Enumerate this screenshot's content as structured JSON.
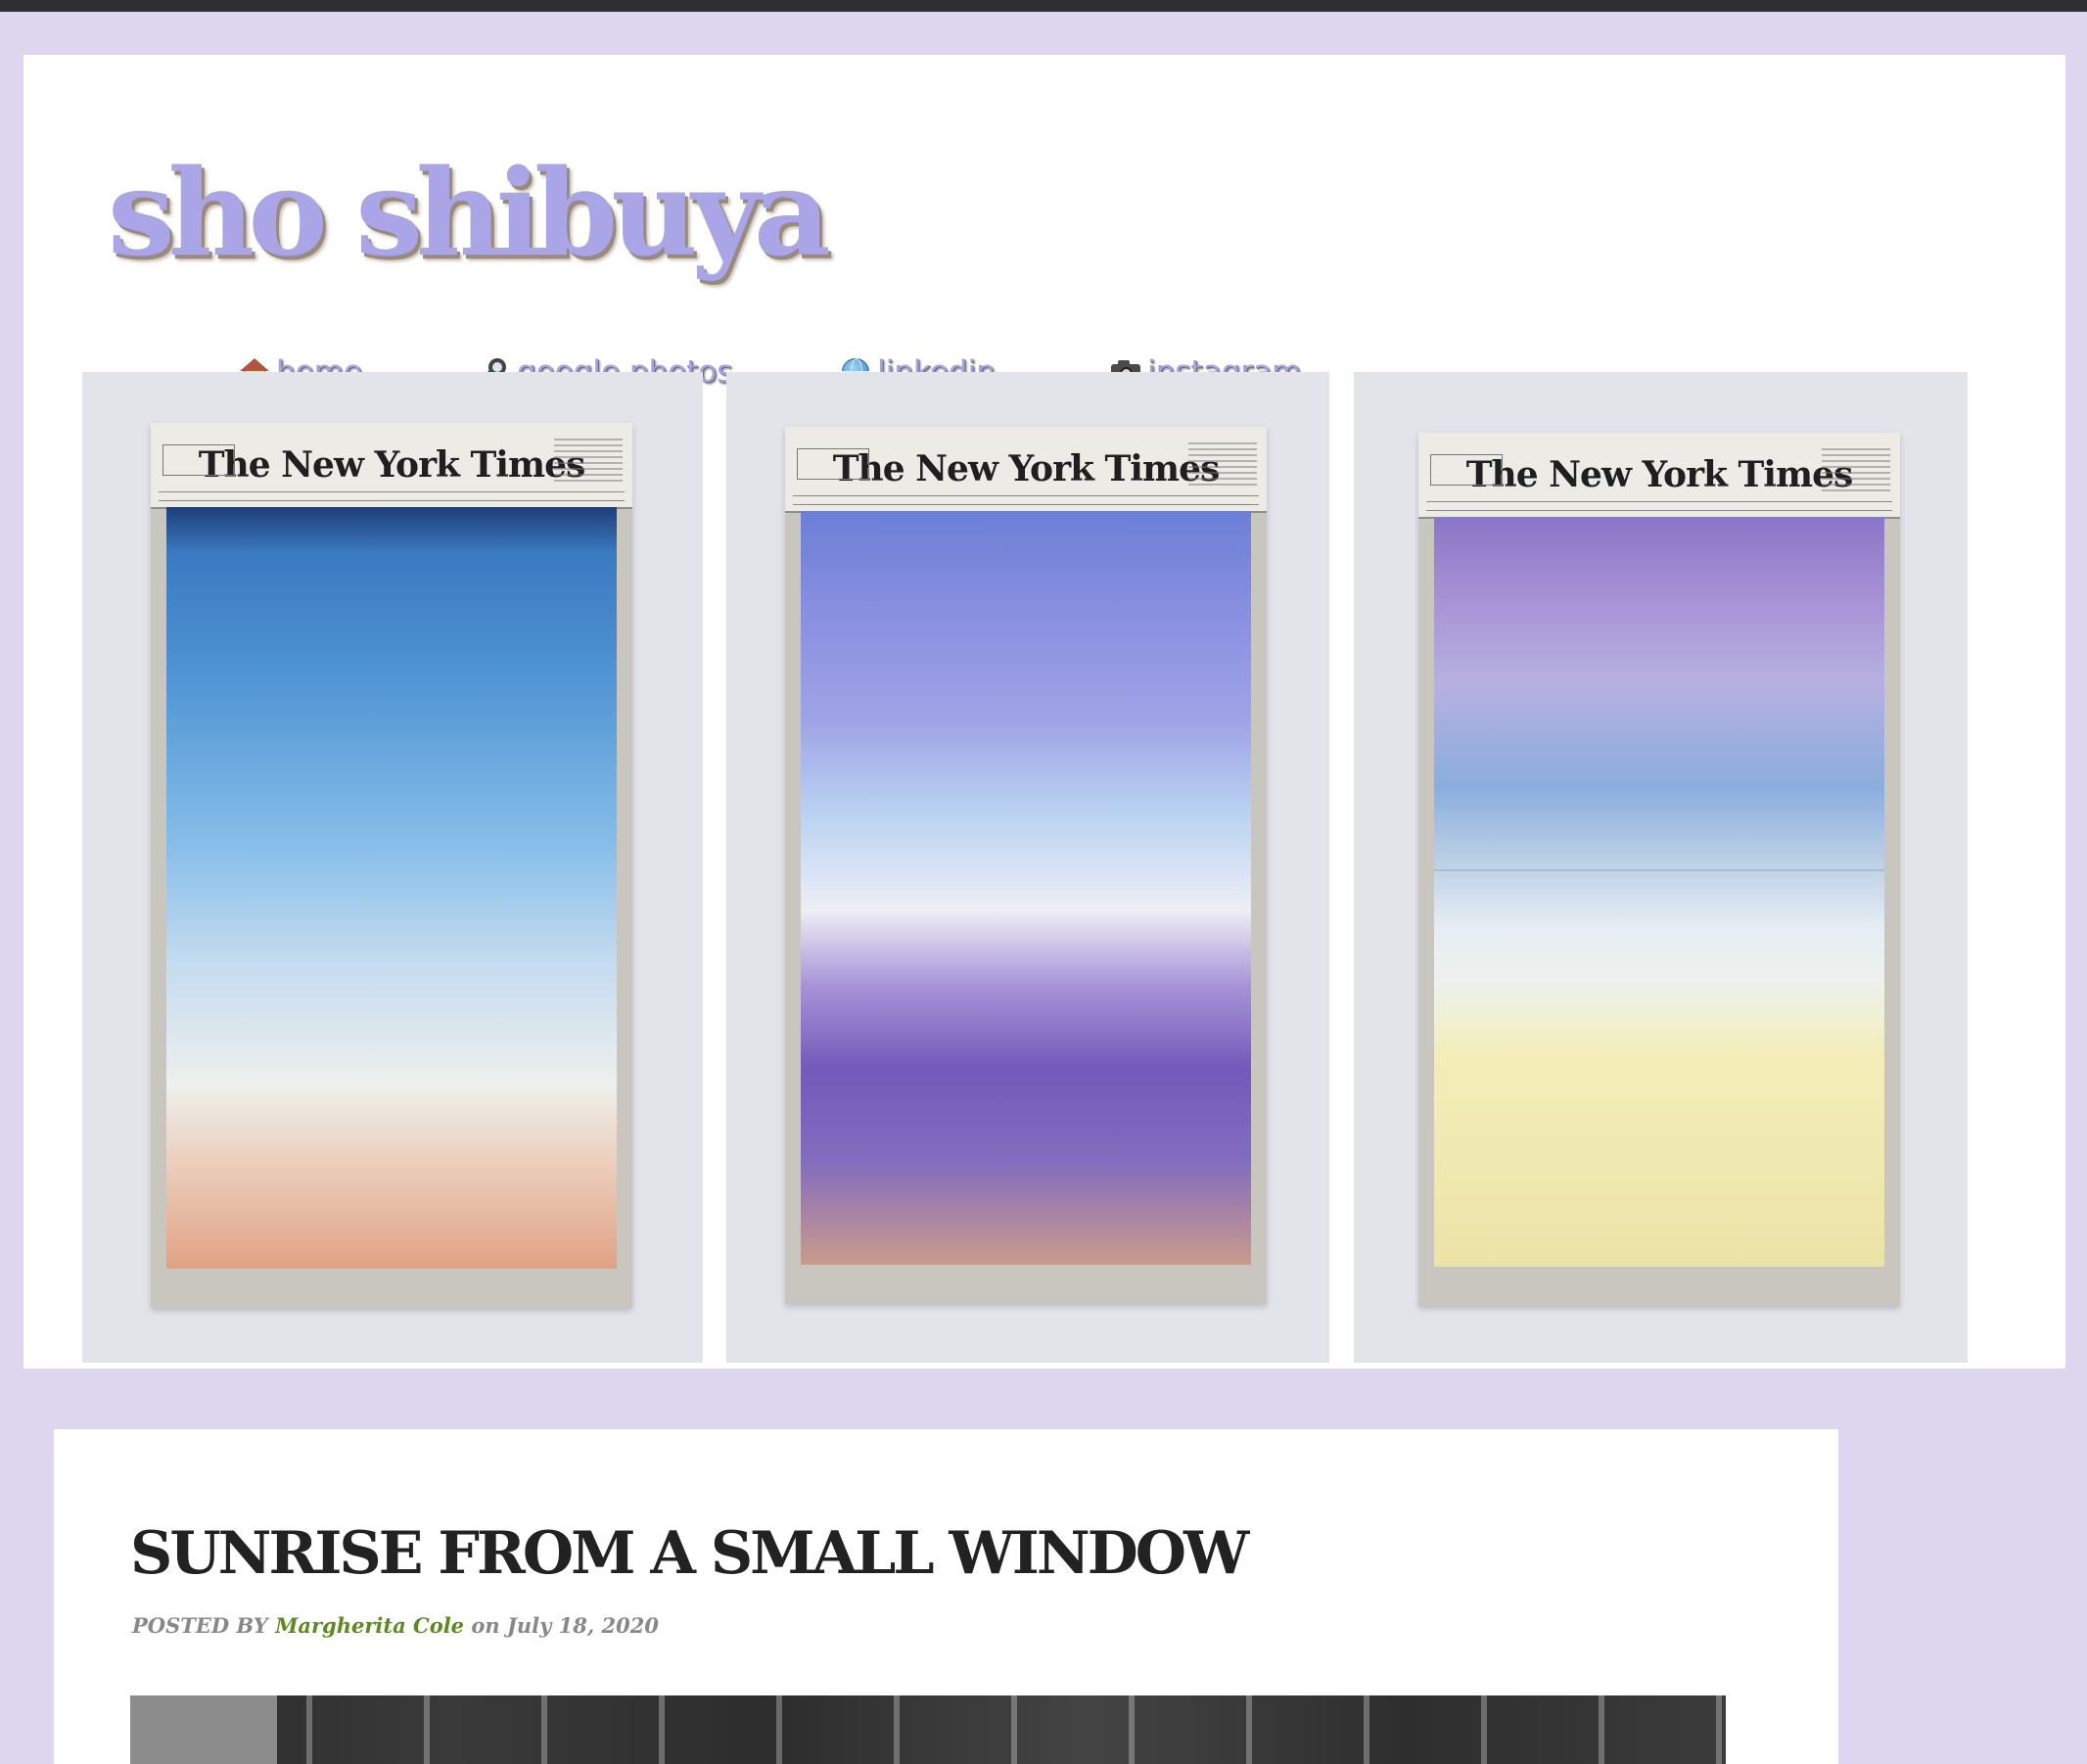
{
  "site": {
    "title": "sho shibuya"
  },
  "nav": {
    "items": [
      {
        "key": "home",
        "label": "home",
        "icon": "house-icon"
      },
      {
        "key": "google_photos",
        "label": "google photos",
        "icon": "magnifier-icon"
      },
      {
        "key": "linkedin",
        "label": "linkedin",
        "icon": "globe-icon"
      },
      {
        "key": "instagram",
        "label": "instagram",
        "icon": "camera-icon"
      }
    ]
  },
  "gallery": {
    "masthead": "The New York Times",
    "photos": [
      {
        "palette": [
          "#1d3f78",
          "#4f94d4",
          "#c5dcef",
          "#e0a285"
        ]
      },
      {
        "palette": [
          "#6a7fd6",
          "#b9d2f1",
          "#7459b9",
          "#c99b89"
        ]
      },
      {
        "palette": [
          "#8a76c8",
          "#8aaede",
          "#eef1ed",
          "#ece3a8"
        ]
      }
    ]
  },
  "post": {
    "title": "SUNRISE FROM A SMALL WINDOW",
    "posted_by_prefix": "POSTED BY",
    "author": "Margherita Cole",
    "date_prefix": "on",
    "date": "July 18, 2020"
  },
  "colors": {
    "page_background": "#ddd6ef",
    "title_lavender": "#a9a5e7",
    "author_link": "#5d8a1e",
    "post_title": "#222222"
  }
}
